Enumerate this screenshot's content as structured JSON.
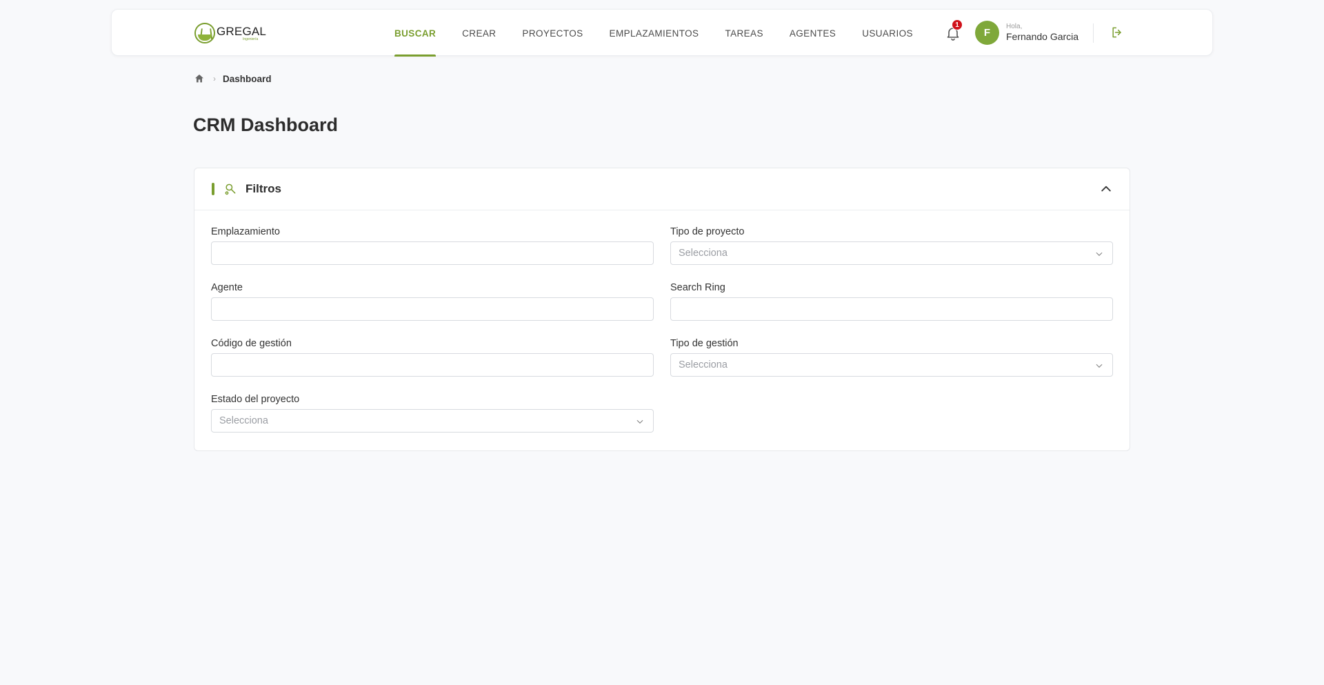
{
  "brand": {
    "name": "GREGAL",
    "tagline": "Ingeniería"
  },
  "nav": [
    {
      "label": "BUSCAR",
      "active": true
    },
    {
      "label": "CREAR"
    },
    {
      "label": "PROYECTOS"
    },
    {
      "label": "EMPLAZAMIENTOS"
    },
    {
      "label": "TAREAS"
    },
    {
      "label": "AGENTES"
    },
    {
      "label": "USUARIOS"
    }
  ],
  "notifications": {
    "icon": "bell-icon",
    "count": "1"
  },
  "user": {
    "initial": "F",
    "greeting": "Hola,",
    "name": "Fernando Garcia"
  },
  "breadcrumb": {
    "home_icon": "home-icon",
    "current": "Dashboard"
  },
  "page": {
    "title": "CRM Dashboard"
  },
  "filters": {
    "title": "Filtros",
    "fields": {
      "emplazamiento": {
        "label": "Emplazamiento",
        "value": ""
      },
      "tipo_proyecto": {
        "label": "Tipo de proyecto",
        "placeholder": "Selecciona"
      },
      "agente": {
        "label": "Agente",
        "value": ""
      },
      "search_ring": {
        "label": "Search Ring",
        "value": ""
      },
      "codigo_gestion": {
        "label": "Código de gestión",
        "value": ""
      },
      "tipo_gestion": {
        "label": "Tipo de gestión",
        "placeholder": "Selecciona"
      },
      "estado_proyecto": {
        "label": "Estado del proyecto",
        "placeholder": "Selecciona"
      }
    }
  },
  "colors": {
    "accent": "#7a9e2f",
    "badge": "#d0121b",
    "background": "#f8f9fb"
  }
}
